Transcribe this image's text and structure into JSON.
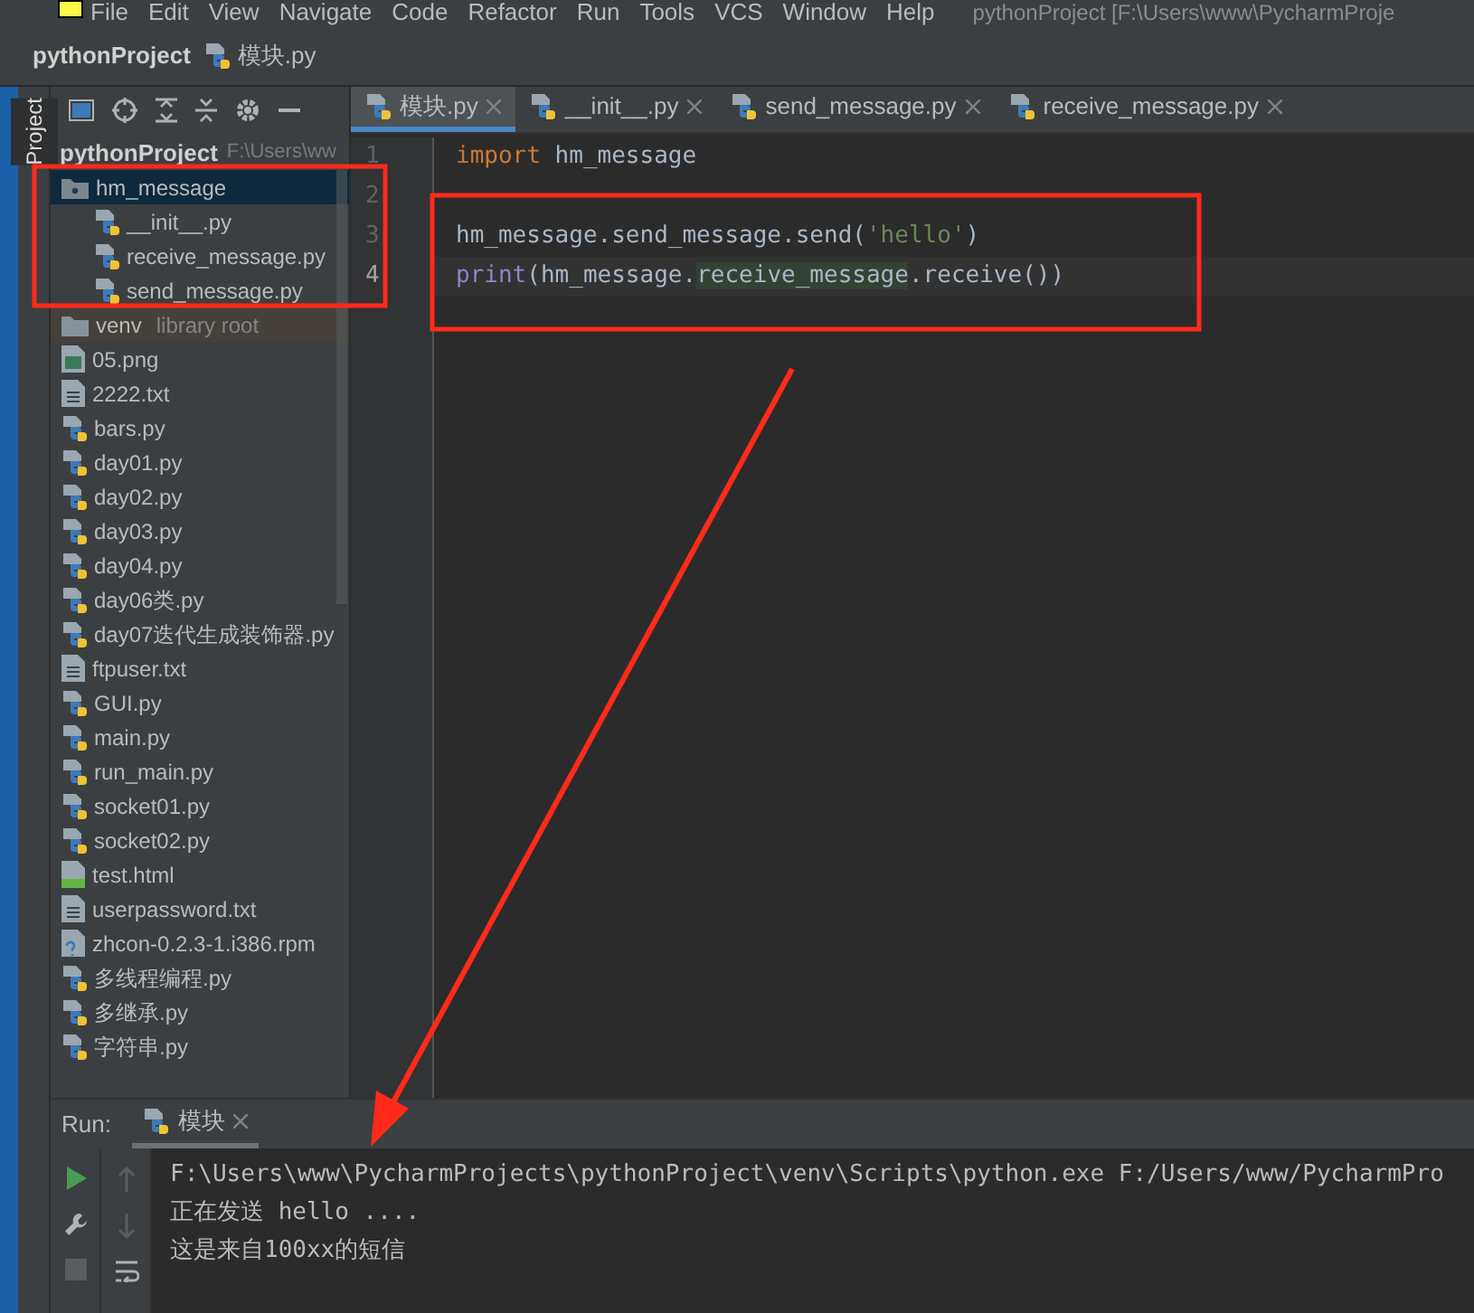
{
  "menu_bar": {
    "items": [
      "File",
      "Edit",
      "View",
      "Navigate",
      "Code",
      "Refactor",
      "Run",
      "Tools",
      "VCS",
      "Window",
      "Help"
    ],
    "window_title": "pythonProject [F:\\Users\\www\\PycharmProje"
  },
  "breadcrumb": [
    "pythonProject",
    "模块.py"
  ],
  "side_tab": "Project",
  "project": {
    "root": "pythonProject",
    "root_path": "F:\\Users\\ww",
    "items": [
      {
        "label": "hm_message",
        "kind": "folder",
        "selected": true,
        "expanded": true,
        "children": [
          {
            "label": "__init__.py",
            "kind": "python"
          },
          {
            "label": "receive_message.py",
            "kind": "python"
          },
          {
            "label": "send_message.py",
            "kind": "python"
          }
        ]
      },
      {
        "label": "venv",
        "kind": "folder",
        "note": "library root",
        "selected": false
      },
      {
        "label": "05.png",
        "kind": "image"
      },
      {
        "label": "2222.txt",
        "kind": "text"
      },
      {
        "label": "bars.py",
        "kind": "python"
      },
      {
        "label": "day01.py",
        "kind": "python"
      },
      {
        "label": "day02.py",
        "kind": "python"
      },
      {
        "label": "day03.py",
        "kind": "python"
      },
      {
        "label": "day04.py",
        "kind": "python"
      },
      {
        "label": "day06类.py",
        "kind": "python"
      },
      {
        "label": "day07迭代生成装饰器.py",
        "kind": "python"
      },
      {
        "label": "ftpuser.txt",
        "kind": "text"
      },
      {
        "label": "GUI.py",
        "kind": "python"
      },
      {
        "label": "main.py",
        "kind": "python"
      },
      {
        "label": "run_main.py",
        "kind": "python"
      },
      {
        "label": "socket01.py",
        "kind": "python"
      },
      {
        "label": "socket02.py",
        "kind": "python"
      },
      {
        "label": "test.html",
        "kind": "html"
      },
      {
        "label": "userpassword.txt",
        "kind": "text"
      },
      {
        "label": "zhcon-0.2.3-1.i386.rpm",
        "kind": "unknown"
      },
      {
        "label": "多线程编程.py",
        "kind": "python"
      },
      {
        "label": "多继承.py",
        "kind": "python"
      },
      {
        "label": "字符串.py",
        "kind": "python"
      }
    ]
  },
  "tabs": [
    {
      "label": "模块.py",
      "selected": true
    },
    {
      "label": "__init__.py",
      "selected": false
    },
    {
      "label": "send_message.py",
      "selected": false
    },
    {
      "label": "receive_message.py",
      "selected": false
    }
  ],
  "editor": {
    "lines": [
      {
        "number": "1",
        "current": false,
        "tokens": [
          {
            "text": "import",
            "kind": "keyword"
          },
          {
            "text": " hm_message",
            "kind": "plain"
          }
        ]
      },
      {
        "number": "2",
        "current": false
      },
      {
        "number": "3",
        "current": false,
        "tokens": [
          {
            "text": "hm_message.send_message.send(",
            "kind": "plain"
          },
          {
            "text": "'hello'",
            "kind": "string"
          },
          {
            "text": ")",
            "kind": "plain"
          }
        ]
      },
      {
        "number": "4",
        "current": true,
        "tokens": [
          {
            "text": "print",
            "kind": "builtin"
          },
          {
            "text": "(hm_message.",
            "kind": "plain"
          },
          {
            "text": "receive_message",
            "kind": "match"
          },
          {
            "text": ".receive())",
            "kind": "plain"
          }
        ]
      }
    ]
  },
  "run": {
    "label": "Run:",
    "tab": "模块",
    "console": [
      "F:\\Users\\www\\PycharmProjects\\pythonProject\\venv\\Scripts\\python.exe F:/Users/www/PycharmPro",
      "正在发送 hello ....",
      "这是来自100xx的短信"
    ]
  }
}
